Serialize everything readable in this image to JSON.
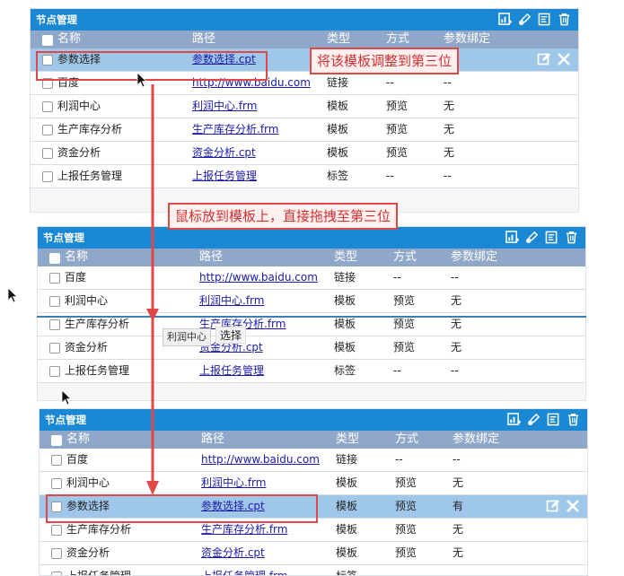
{
  "panel_title": "节点管理",
  "headers": {
    "name": "名称",
    "path": "路径",
    "type": "类型",
    "mode": "方式",
    "param": "参数绑定"
  },
  "icons": [
    "chart-add-icon",
    "edit-link-icon",
    "form-icon",
    "trash-icon"
  ],
  "panel1": {
    "rows": [
      {
        "name": "参数选择",
        "path": "参数选择.cpt",
        "type": "",
        "mode": "",
        "param": "",
        "selected": true
      },
      {
        "name": "百度",
        "path": "http://www.baidu.com",
        "type": "链接",
        "mode": "--",
        "param": "--"
      },
      {
        "name": "利润中心",
        "path": "利润中心.frm",
        "type": "模板",
        "mode": "预览",
        "param": "无"
      },
      {
        "name": "生产库存分析",
        "path": "生产库存分析.frm",
        "type": "模板",
        "mode": "预览",
        "param": "无"
      },
      {
        "name": "资金分析",
        "path": "资金分析.cpt",
        "type": "模板",
        "mode": "预览",
        "param": "无"
      },
      {
        "name": "上报任务管理",
        "path": "上报任务管理",
        "type": "标签",
        "mode": "--",
        "param": "--"
      }
    ],
    "callout": "将该模板调整到第三位"
  },
  "panel2": {
    "rows": [
      {
        "name": "百度",
        "path": "http://www.baidu.com",
        "type": "链接",
        "mode": "--",
        "param": "--"
      },
      {
        "name": "利润中心",
        "path": "利润中心.frm",
        "type": "模板",
        "mode": "预览",
        "param": "无"
      },
      {
        "name": "生产库存分析",
        "path": "生产库存分析.frm",
        "type": "模板",
        "mode": "预览",
        "param": "无"
      },
      {
        "name": "资金分析",
        "path": "资金分析.cpt",
        "type": "模板",
        "mode": "预览",
        "param": "无"
      },
      {
        "name": "上报任务管理",
        "path": "上报任务管理",
        "type": "标签",
        "mode": "--",
        "param": "--"
      }
    ],
    "drag_tooltip": "利润中心",
    "drag_label": "选择",
    "callout": "鼠标放到模板上，直接拖拽至第三位"
  },
  "panel3": {
    "rows": [
      {
        "name": "百度",
        "path": "http://www.baidu.com",
        "type": "链接",
        "mode": "--",
        "param": "--"
      },
      {
        "name": "利润中心",
        "path": "利润中心.frm",
        "type": "模板",
        "mode": "预览",
        "param": "无"
      },
      {
        "name": "参数选择",
        "path": "参数选择.cpt",
        "type": "模板",
        "mode": "预览",
        "param": "有",
        "selected": true
      },
      {
        "name": "生产库存分析",
        "path": "生产库存分析.frm",
        "type": "模板",
        "mode": "预览",
        "param": "无"
      },
      {
        "name": "资金分析",
        "path": "资金分析.cpt",
        "type": "模板",
        "mode": "预览",
        "param": "无"
      },
      {
        "name": "上报任务管理",
        "path": "上报任务管理.frm",
        "type": "标签",
        "mode": "--",
        "param": "--"
      }
    ]
  }
}
